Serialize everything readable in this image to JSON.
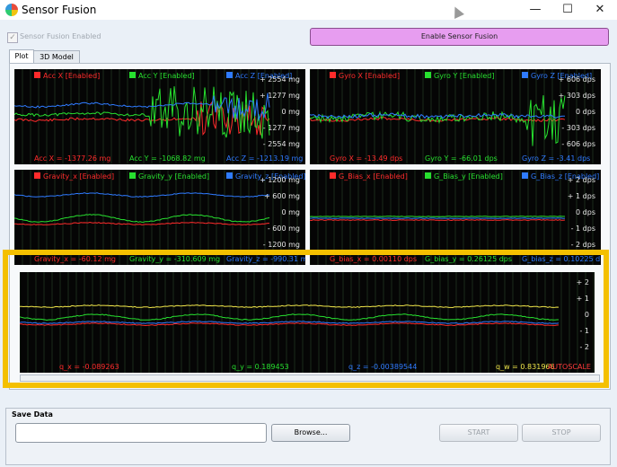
{
  "window": {
    "title": "Sensor Fusion",
    "minimize": "—",
    "maximize": "☐",
    "close": "✕"
  },
  "toolbar": {
    "checkbox_label": "Sensor Fusion Enabled",
    "checkbox_checked": true,
    "enable_button": "Enable Sensor Fusion"
  },
  "tabs": [
    {
      "label": "Plot",
      "active": true
    },
    {
      "label": "3D Model",
      "active": false
    }
  ],
  "plots": {
    "acc": {
      "legend": [
        "Acc X [Enabled]",
        "Acc Y [Enabled]",
        "Acc Z [Enabled]"
      ],
      "ticks": [
        "+ 2554 mg",
        "+ 1277 mg",
        "0 mg",
        "- 1277 mg",
        "- 2554 mg"
      ],
      "readouts": [
        "Acc X = -1377.26 mg",
        "Acc Y = -1068.82 mg",
        "Acc Z = -1213.19 mg"
      ]
    },
    "gyro": {
      "legend": [
        "Gyro X [Enabled]",
        "Gyro Y [Enabled]",
        "Gyro Z [Enabled]"
      ],
      "ticks": [
        "+ 606 dps",
        "+ 303 dps",
        "0 dps",
        "- 303 dps",
        "- 606 dps"
      ],
      "readouts": [
        "Gyro X = -13.49 dps",
        "Gyro Y = -66.01 dps",
        "Gyro Z = -3.41 dps"
      ]
    },
    "gravity": {
      "legend": [
        "Gravity_x [Enabled]",
        "Gravity_y [Enabled]",
        "Gravity_z [Enabled]"
      ],
      "ticks": [
        "+ 1200 mg",
        "+ 600 mg",
        "0 mg",
        "- 600 mg",
        "- 1200 mg"
      ],
      "readouts": [
        "Gravity_x = -60.12 mg",
        "Gravity_y = -310.609 mg",
        "Gravity_z = -990.31 mg"
      ]
    },
    "gbias": {
      "legend": [
        "G_Bias_x [Enabled]",
        "G_Bias_y [Enabled]",
        "G_Bias_z [Enabled]"
      ],
      "ticks": [
        "+ 2 dps",
        "+ 1 dps",
        "0 dps",
        "- 1 dps",
        "- 2 dps"
      ],
      "readouts": [
        "G_bias_x = 0.00110 dps",
        "G_bias_y = 0.26125 dps",
        "G_bias_z = 0.10225 dps"
      ]
    },
    "quat": {
      "ticks": [
        "+ 2",
        "+ 1",
        "0",
        "- 1",
        "- 2"
      ],
      "readouts": [
        "q_x = -0.089263",
        "q_y = 0.189453",
        "q_z = -0.00389544",
        "q_w = 0.831966"
      ],
      "autoscale": "AUTOSCALE"
    }
  },
  "save": {
    "title": "Save Data",
    "path_value": "",
    "browse": "Browse...",
    "start": "START",
    "stop": "STOP"
  },
  "colors": {
    "x": "#ff2b2b",
    "y": "#27e02f",
    "z": "#2f7bff",
    "w": "#f0e64a",
    "highlight": "#f4c000",
    "enable_button": "#e79df0"
  }
}
